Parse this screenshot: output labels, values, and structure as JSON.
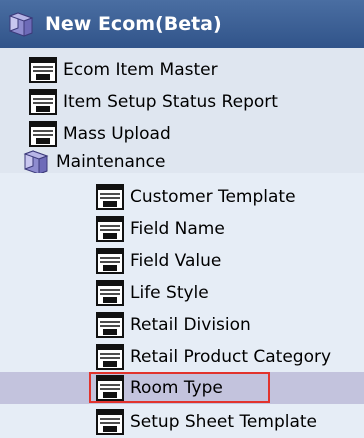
{
  "header": {
    "title": "New Ecom(Beta)",
    "icon": "folder-icon"
  },
  "tree": {
    "items": [
      {
        "label": "Ecom Item Master",
        "icon": "form-icon"
      },
      {
        "label": "Item Setup Status Report",
        "icon": "form-icon"
      },
      {
        "label": "Mass Upload",
        "icon": "form-icon"
      }
    ],
    "maintenance": {
      "label": "Maintenance",
      "icon": "folder-icon",
      "children": [
        {
          "label": "Customer Template",
          "icon": "form-icon"
        },
        {
          "label": "Field Name",
          "icon": "form-icon"
        },
        {
          "label": "Field Value",
          "icon": "form-icon"
        },
        {
          "label": "Life Style",
          "icon": "form-icon"
        },
        {
          "label": "Retail Division",
          "icon": "form-icon"
        },
        {
          "label": "Retail Product Category",
          "icon": "form-icon"
        },
        {
          "label": "Room Type",
          "icon": "form-icon",
          "selected": true
        },
        {
          "label": "Setup Sheet Template",
          "icon": "form-icon"
        }
      ]
    }
  },
  "colors": {
    "header_bg": "#3d5f94",
    "panel_bg": "#dfe6f0",
    "selected_bg": "#c3c3dd",
    "highlight_border": "#e2332d"
  }
}
